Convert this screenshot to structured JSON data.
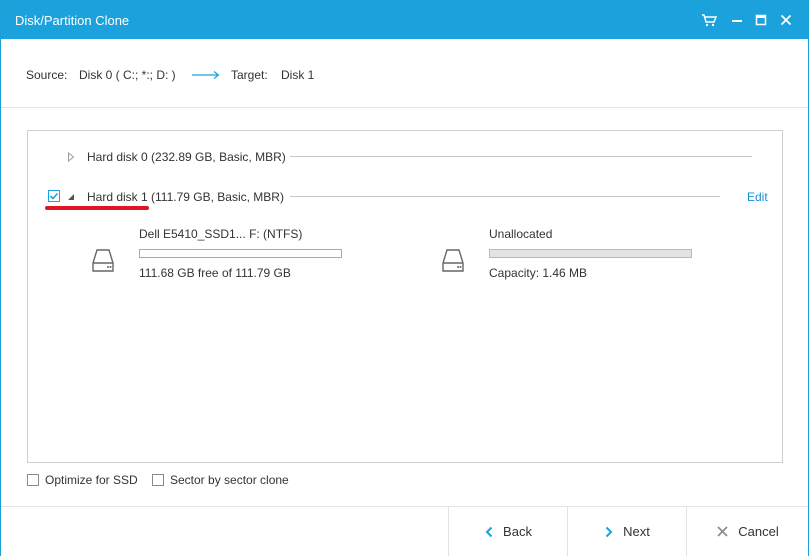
{
  "window": {
    "title": "Disk/Partition Clone"
  },
  "header": {
    "source_label": "Source:",
    "source_value": "Disk 0 ( C:; *:; D: )",
    "target_label": "Target:",
    "target_value": "Disk 1"
  },
  "disks": [
    {
      "label": "Hard disk 0 (232.89 GB, Basic, MBR)",
      "expanded": false,
      "checked": false
    },
    {
      "label": "Hard disk 1 (111.79 GB, Basic, MBR)",
      "expanded": true,
      "checked": true,
      "edit_label": "Edit"
    }
  ],
  "partitions": [
    {
      "name": "Dell E5410_SSD1... F: (NTFS)",
      "detail": "111.68 GB free of 111.79 GB",
      "icon": "hard-drive-icon"
    },
    {
      "name": "Unallocated",
      "detail": "Capacity: 1.46 MB",
      "icon": "hard-drive-icon"
    }
  ],
  "options": {
    "optimize_ssd": {
      "label": "Optimize for SSD",
      "checked": false
    },
    "sector_clone": {
      "label": "Sector by sector clone",
      "checked": false
    }
  },
  "buttons": {
    "back": "Back",
    "next": "Next",
    "cancel": "Cancel"
  },
  "colors": {
    "accent": "#1ba1dc",
    "annotation": "#e0161e",
    "link": "#1a8ecf"
  }
}
